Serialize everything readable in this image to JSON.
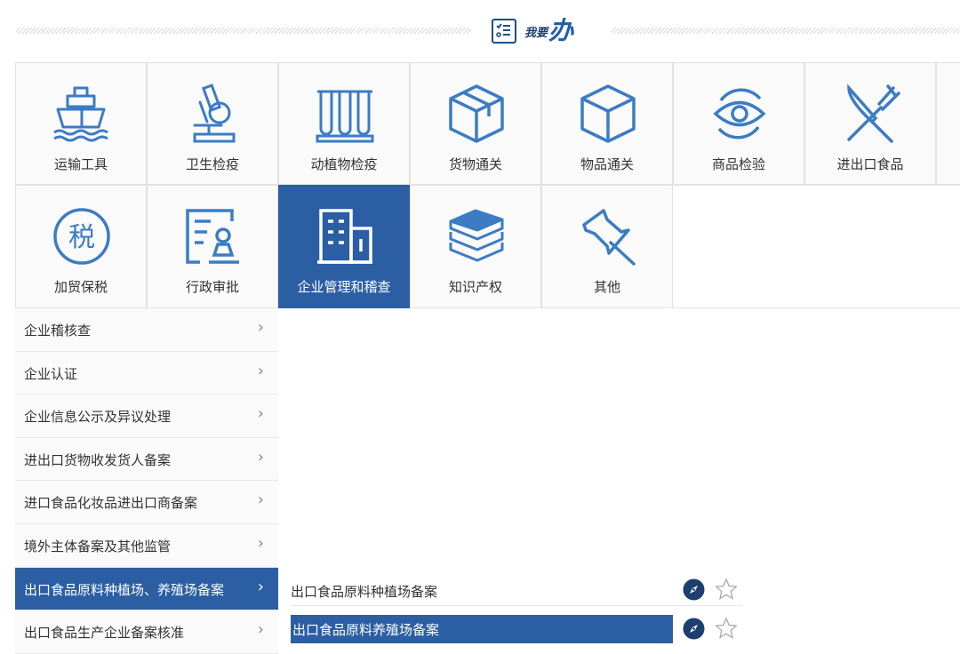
{
  "header": {
    "title_small": "我要",
    "title_big": "办"
  },
  "categories": [
    {
      "label": "运输工具",
      "icon": "ship-icon"
    },
    {
      "label": "卫生检疫",
      "icon": "microscope-icon"
    },
    {
      "label": "动植物检疫",
      "icon": "test-tubes-icon"
    },
    {
      "label": "货物通关",
      "icon": "package-icon"
    },
    {
      "label": "物品通关",
      "icon": "cube-icon"
    },
    {
      "label": "商品检验",
      "icon": "eye-icon"
    },
    {
      "label": "进出口食品",
      "icon": "fork-knife-icon"
    },
    {
      "label": "加贸保税",
      "icon": "tax-icon"
    },
    {
      "label": "行政审批",
      "icon": "approval-stamp-icon"
    },
    {
      "label": "企业管理和稽查",
      "icon": "building-icon"
    },
    {
      "label": "知识产权",
      "icon": "books-icon"
    },
    {
      "label": "其他",
      "icon": "pin-icon"
    }
  ],
  "active_category": "企业管理和稽查",
  "menu": [
    {
      "label": "企业稽核查"
    },
    {
      "label": "企业认证"
    },
    {
      "label": "企业信息公示及异议处理"
    },
    {
      "label": "进出口货物收发货人备案"
    },
    {
      "label": "进口食品化妆品进出口商备案"
    },
    {
      "label": "境外主体备案及其他监管"
    },
    {
      "label": "出口食品原料种植场、养殖场备案"
    },
    {
      "label": "出口食品生产企业备案核准"
    }
  ],
  "active_menu": "出口食品原料种植场、养殖场备案",
  "submenu": [
    {
      "label": "出口食品原料种植场备案",
      "icons": [
        "compass-icon",
        "star-icon"
      ]
    },
    {
      "label": "出口食品原料养殖场备案",
      "icons": [
        "compass-icon",
        "star-icon"
      ]
    }
  ],
  "colors": {
    "accent": "#2b5ea3",
    "icon": "#3b7cc4"
  }
}
